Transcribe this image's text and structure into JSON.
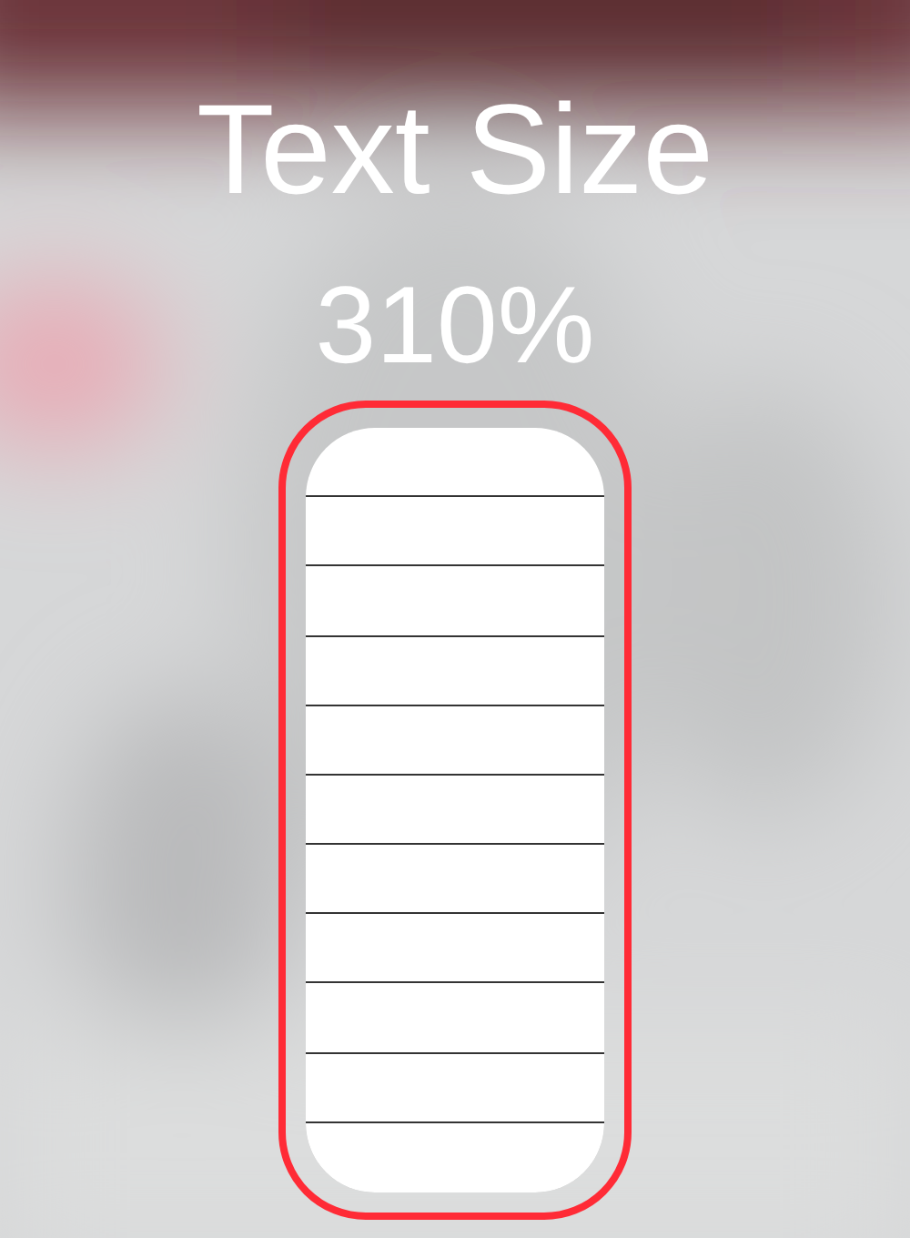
{
  "title": "Text Size",
  "slider": {
    "reading": "310%",
    "highlighted": true
  }
}
